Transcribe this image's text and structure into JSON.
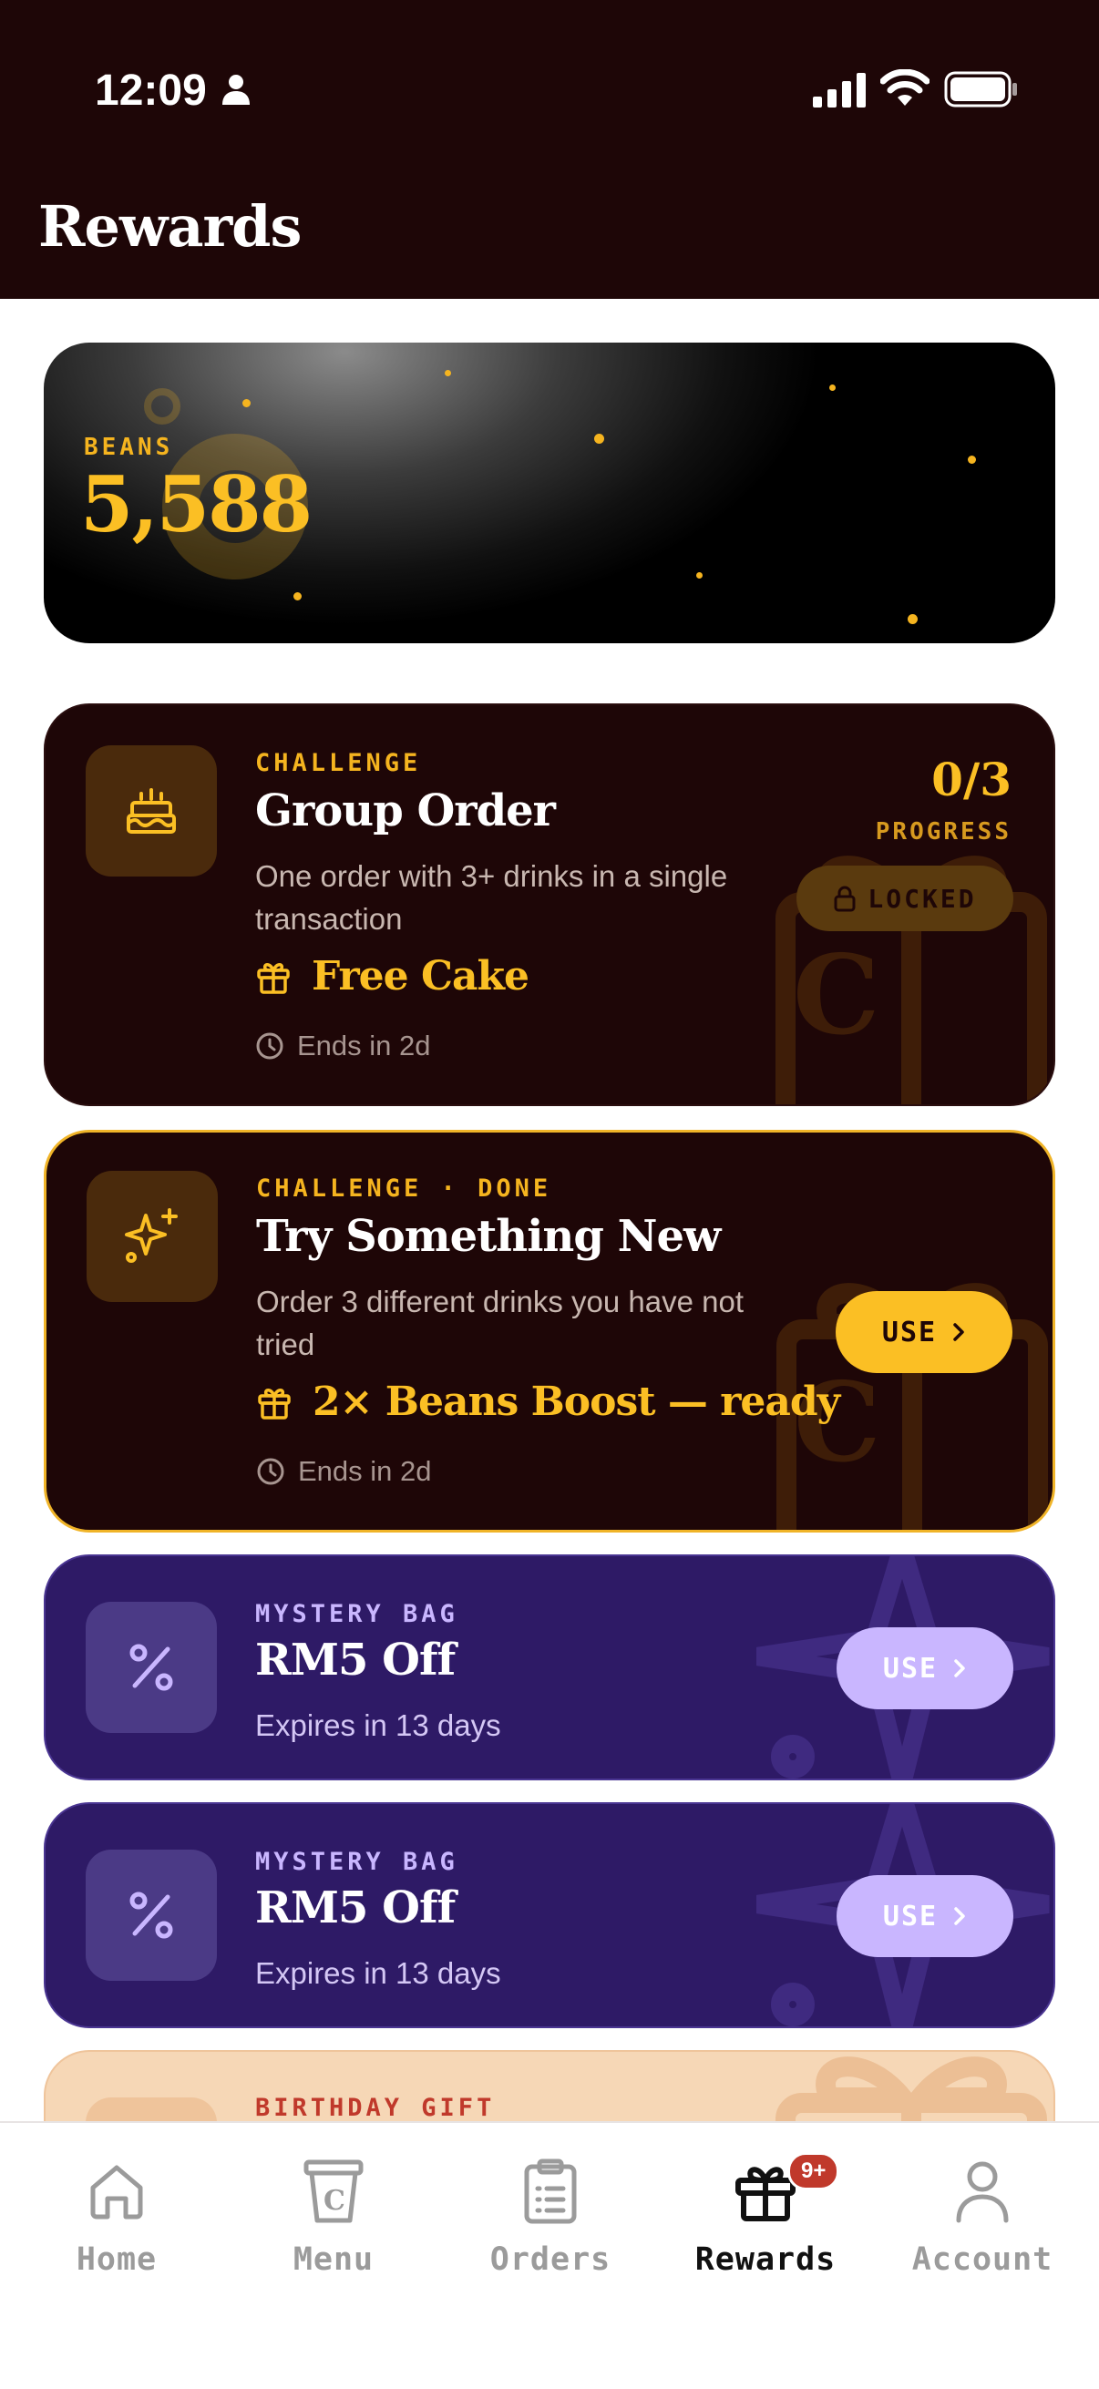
{
  "status_bar": {
    "time": "12:09"
  },
  "header": {
    "title": "Rewards"
  },
  "beans": {
    "label": "BEANS",
    "value": "5,588"
  },
  "challenge_group": {
    "eyebrow": "CHALLENGE",
    "title": "Group Order",
    "description": "One order with 3+ drinks in a single transaction",
    "reward": "Free Cake",
    "ends": "Ends in 2d",
    "progress_value": "0/3",
    "progress_label": "PROGRESS",
    "locked_label": "LOCKED"
  },
  "challenge_new": {
    "eyebrow": "CHALLENGE · DONE",
    "title": "Try Something New",
    "description": "Order 3 different drinks you have not tried",
    "reward": "2× Beans Boost — ready",
    "ends": "Ends in 2d",
    "use_label": "USE"
  },
  "mystery_1": {
    "eyebrow": "MYSTERY BAG",
    "title": "RM5 Off",
    "expires": "Expires in 13 days",
    "use_label": "USE"
  },
  "mystery_2": {
    "eyebrow": "MYSTERY BAG",
    "title": "RM5 Off",
    "expires": "Expires in 13 days",
    "use_label": "USE"
  },
  "birthday": {
    "eyebrow": "BIRTHDAY GIFT"
  },
  "nav": {
    "items": [
      {
        "label": "Home",
        "icon": "home-icon"
      },
      {
        "label": "Menu",
        "icon": "cup-icon"
      },
      {
        "label": "Orders",
        "icon": "clipboard-icon"
      },
      {
        "label": "Rewards",
        "icon": "gift-icon",
        "badge": "9+",
        "active": true
      },
      {
        "label": "Account",
        "icon": "person-icon"
      }
    ]
  },
  "colors": {
    "header_bg": "#1e0607",
    "gold": "#fbbf24",
    "mystery_bg": "#2e1a66",
    "badge": "#c0392b"
  }
}
